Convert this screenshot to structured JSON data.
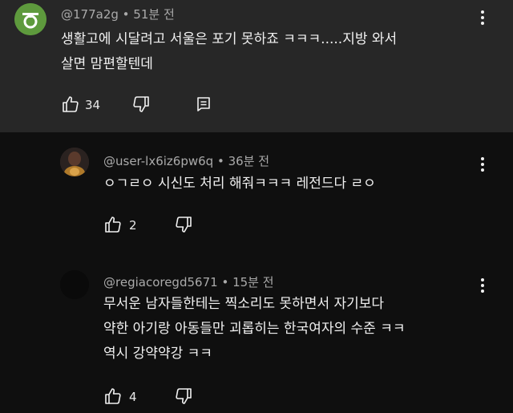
{
  "comments": [
    {
      "author": "@177a2g",
      "time": "51분 전",
      "lines": [
        "생활고에 시달려고 서울은 포기 못하죠 ㅋㅋㅋ.....지방 와서",
        "살면 맘편할텐데"
      ],
      "likes": "34",
      "avatar": {
        "bg": "#5e9a3d",
        "fg": "#ffffff"
      }
    },
    {
      "author": "@user-lx6iz6pw6q",
      "time": "36분 전",
      "lines": [
        "ㅇㄱㄹㅇ 시신도 처리 해줘ㅋㅋㅋ 레전드다 ㄹㅇ"
      ],
      "likes": "2",
      "avatar": {
        "bg": "#3b2f2f",
        "fg": "#d9a24a"
      }
    },
    {
      "author": "@regiacoregd5671",
      "time": "15분 전",
      "lines": [
        "무서운 남자들한테는 찍소리도 못하면서 자기보다",
        "약한 아기랑 아동들만 괴롭히는 한국여자의 수준 ㅋㅋ",
        "역시 강약약강 ㅋㅋ"
      ],
      "likes": "4",
      "avatar": {
        "bg": "#0a0a0a",
        "fg": "#0a0a0a"
      }
    }
  ],
  "icons": {
    "like": "thumbs-up-icon",
    "dislike": "thumbs-down-icon",
    "reply": "reply-icon",
    "more": "more-vert-icon"
  },
  "colors": {
    "card_bg": "#272727",
    "page_bg": "#0f0f0f",
    "meta_text": "#aaaaaa"
  }
}
